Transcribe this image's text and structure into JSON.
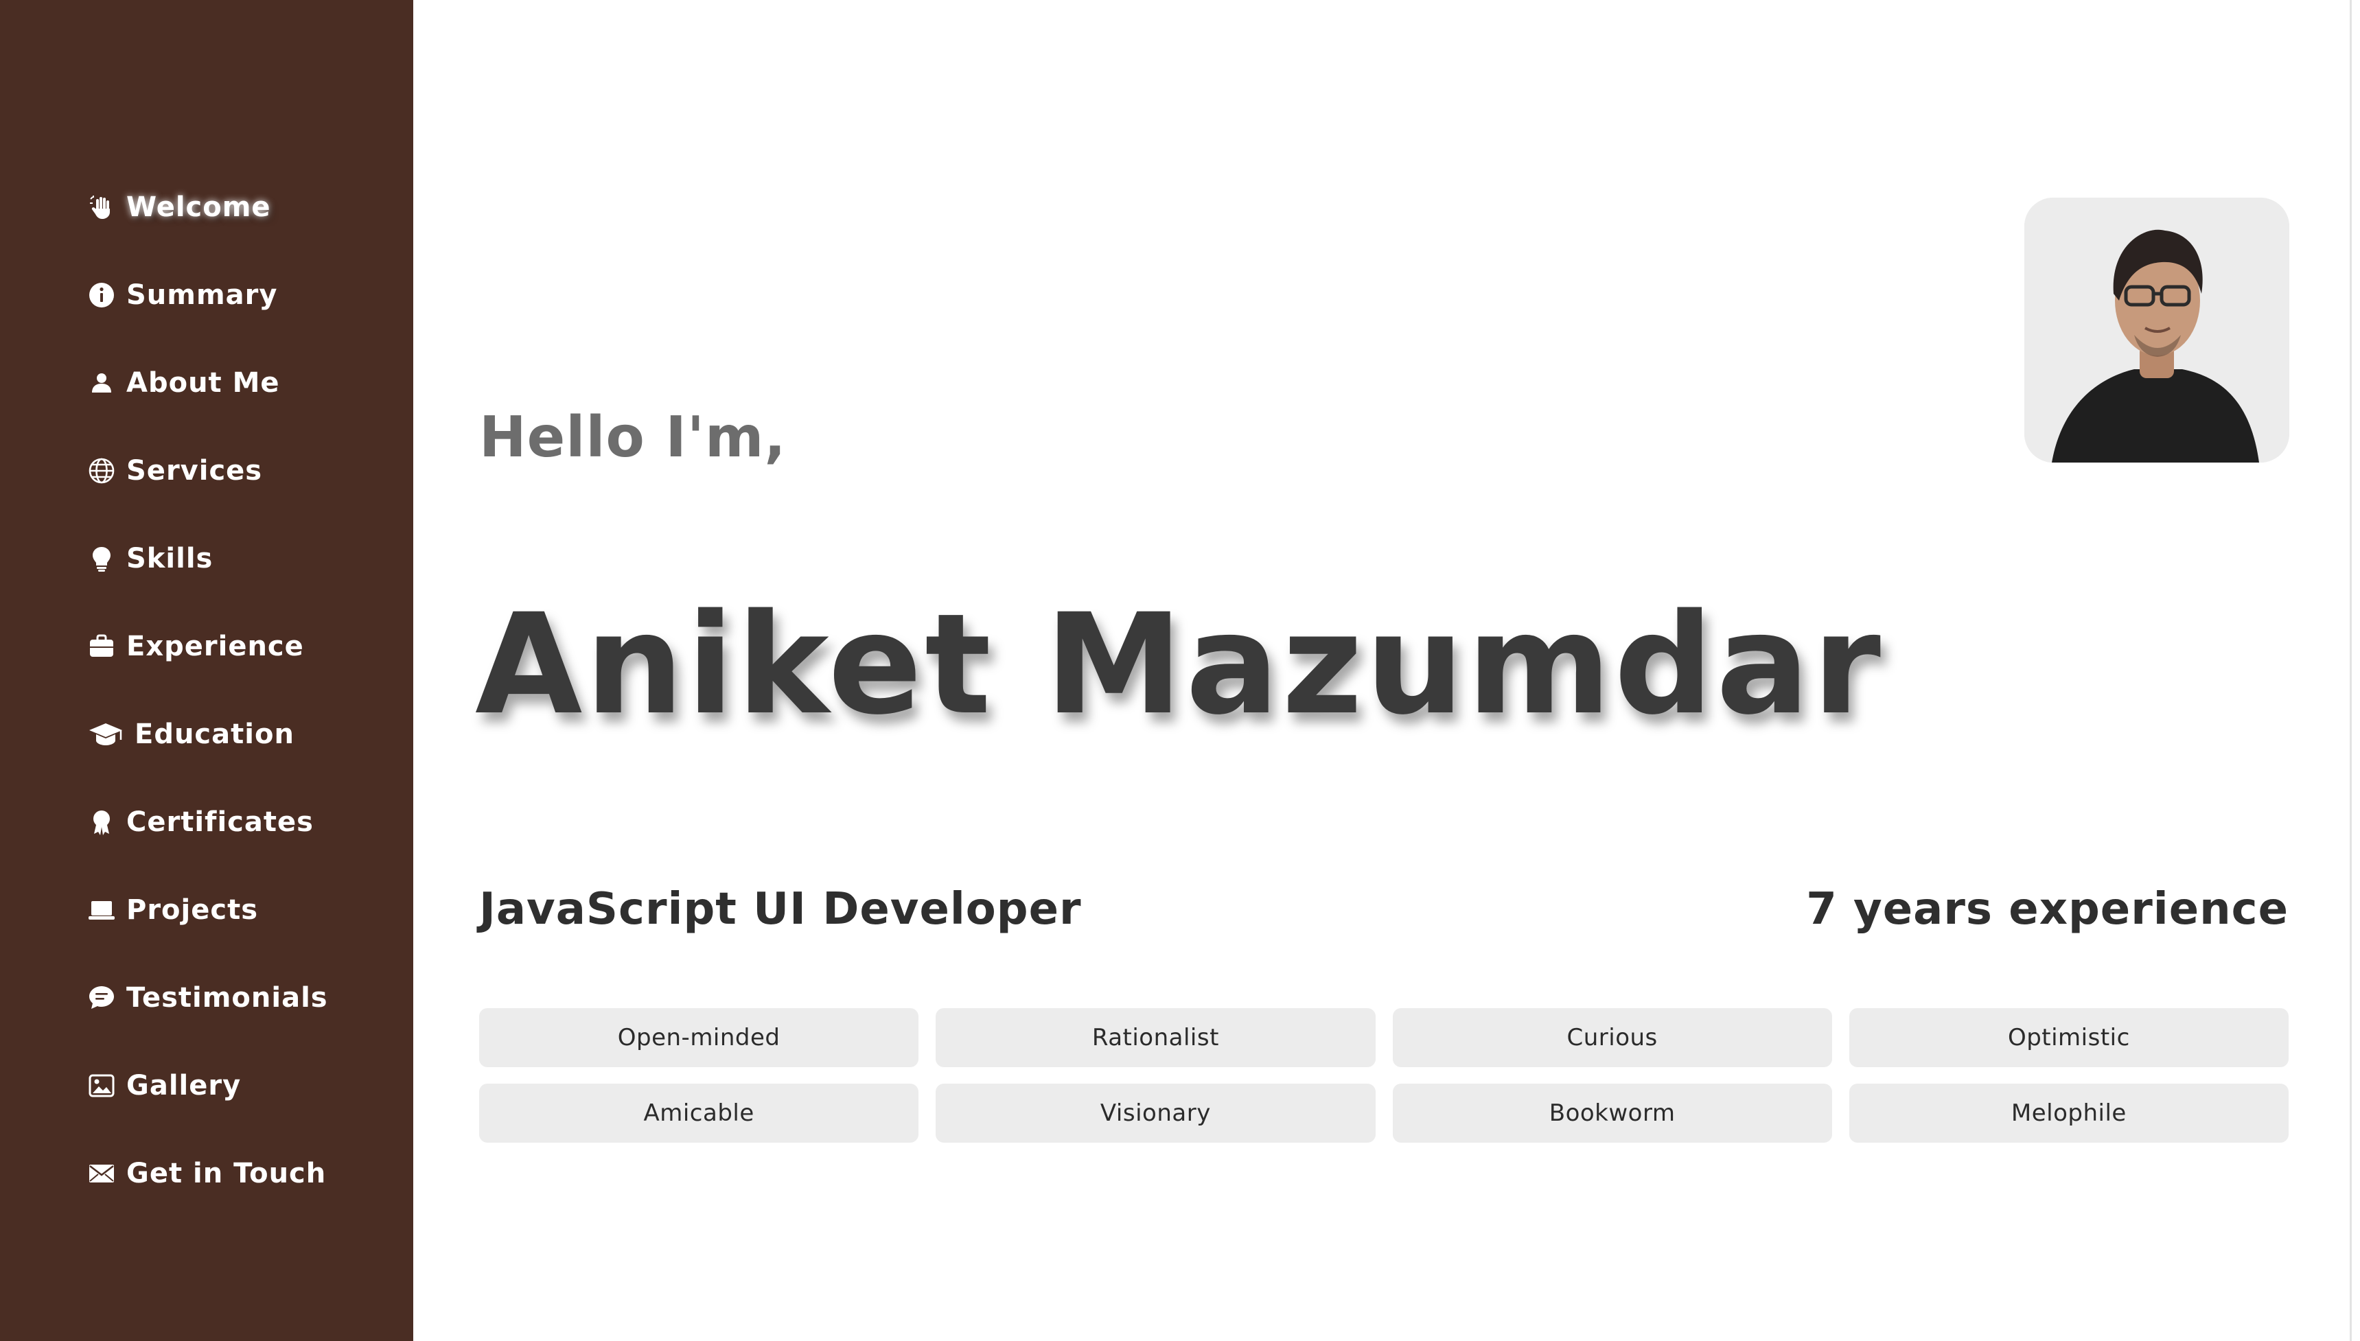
{
  "theme": {
    "sidebar_bg": "#4a2d23",
    "page_bg": "#ffffff",
    "text_dark": "#3a3a3a",
    "text_muted": "#6d6d6d",
    "chip_bg": "#ececec"
  },
  "sidebar": {
    "items": [
      {
        "label": "Welcome",
        "icon": "waving-hand-icon",
        "active": true
      },
      {
        "label": "Summary",
        "icon": "info-icon"
      },
      {
        "label": "About Me",
        "icon": "user-icon"
      },
      {
        "label": "Services",
        "icon": "globe-icon"
      },
      {
        "label": "Skills",
        "icon": "lightbulb-icon"
      },
      {
        "label": "Experience",
        "icon": "briefcase-icon"
      },
      {
        "label": "Education",
        "icon": "graduation-cap-icon"
      },
      {
        "label": "Certificates",
        "icon": "award-icon"
      },
      {
        "label": "Projects",
        "icon": "laptop-icon"
      },
      {
        "label": "Testimonials",
        "icon": "comment-icon"
      },
      {
        "label": "Gallery",
        "icon": "image-icon"
      },
      {
        "label": "Get in Touch",
        "icon": "envelope-icon"
      }
    ]
  },
  "hero": {
    "greeting": "Hello I'm,",
    "name": "Aniket Mazumdar",
    "role": "JavaScript UI Developer",
    "experience": "7 years experience",
    "photo": "profile-photo"
  },
  "traits": [
    "Open-minded",
    "Rationalist",
    "Curious",
    "Optimistic",
    "Amicable",
    "Visionary",
    "Bookworm",
    "Melophile"
  ]
}
